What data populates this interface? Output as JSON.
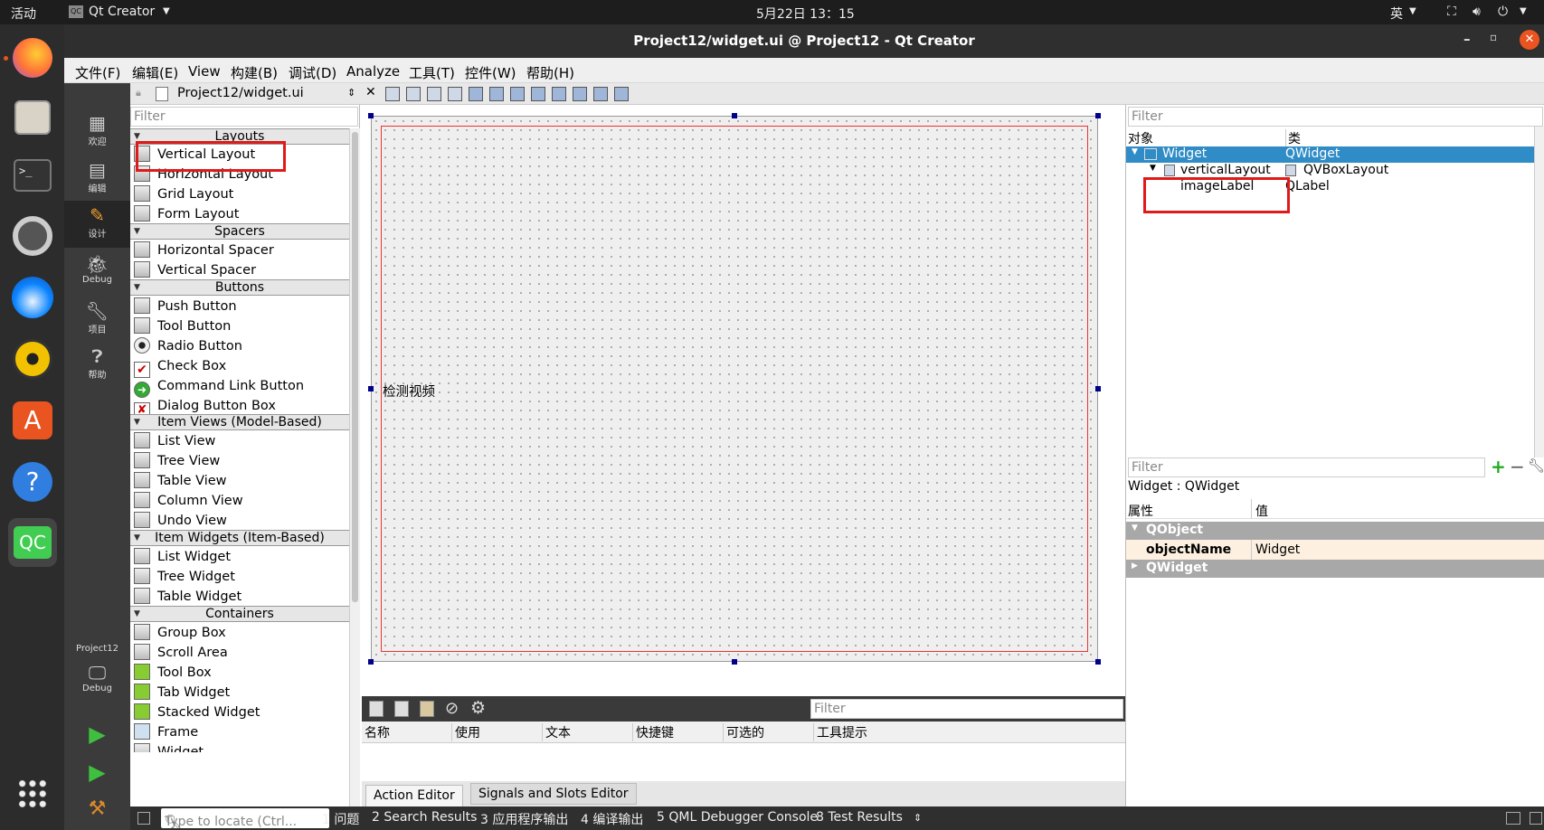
{
  "topbar": {
    "activities": "活动",
    "app": "Qt Creator",
    "clock": "5月22日 13：15",
    "input_method": "英"
  },
  "window": {
    "title": "Project12/widget.ui @ Project12 - Qt Creator"
  },
  "menu": [
    "文件(F)",
    "编辑(E)",
    "View",
    "构建(B)",
    "调试(D)",
    "Analyze",
    "工具(T)",
    "控件(W)",
    "帮助(H)"
  ],
  "modes": {
    "welcome": "欢迎",
    "edit": "编辑",
    "design": "设计",
    "debug": "Debug",
    "projects": "项目",
    "help": "帮助",
    "kit_project": "Project12",
    "kit_build": "Debug"
  },
  "editor": {
    "file": "Project12/widget.ui"
  },
  "widgetbox": {
    "filter_placeholder": "Filter",
    "categories": {
      "layouts": "Layouts",
      "spacers": "Spacers",
      "buttons": "Buttons",
      "item_views": "Item Views (Model-Based)",
      "item_widgets": "Item Widgets (Item-Based)",
      "containers": "Containers"
    },
    "items": [
      "Vertical Layout",
      "Horizontal Layout",
      "Grid Layout",
      "Form Layout",
      "Horizontal Spacer",
      "Vertical Spacer",
      "Push Button",
      "Tool Button",
      "Radio Button",
      "Check Box",
      "Command Link Button",
      "Dialog Button Box",
      "List View",
      "Tree View",
      "Table View",
      "Column View",
      "Undo View",
      "List Widget",
      "Tree Widget",
      "Table Widget",
      "Group Box",
      "Scroll Area",
      "Tool Box",
      "Tab Widget",
      "Stacked Widget",
      "Frame",
      "Widget"
    ]
  },
  "form": {
    "label_text": "检测视频"
  },
  "action_editor": {
    "filter_placeholder": "Filter",
    "columns": [
      "名称",
      "使用",
      "文本",
      "快捷键",
      "可选的",
      "工具提示"
    ],
    "tabs": [
      "Action Editor",
      "Signals and Slots Editor"
    ]
  },
  "object_inspector": {
    "filter_placeholder": "Filter",
    "col_object": "对象",
    "col_class": "类",
    "rows": [
      {
        "name": "Widget",
        "cls": "QWidget"
      },
      {
        "name": "verticalLayout",
        "cls": "QVBoxLayout"
      },
      {
        "name": "imageLabel",
        "cls": "QLabel"
      }
    ]
  },
  "property_editor": {
    "filter_placeholder": "Filter",
    "context": "Widget : QWidget",
    "col_prop": "属性",
    "col_value": "值",
    "group1": "QObject",
    "prop_name": "objectName",
    "prop_value": "Widget",
    "group2": "QWidget"
  },
  "statusbar": {
    "locate_placeholder": "Type to locate (Ctrl...",
    "panes": [
      "1 问题",
      "2 Search Results",
      "3 应用程序输出",
      "4 编译输出",
      "5 QML Debugger Console",
      "8 Test Results"
    ]
  },
  "colors": {
    "selection": "#308cc6",
    "highlight_box": "#e01a1a",
    "dock": "#2c2c2c"
  }
}
